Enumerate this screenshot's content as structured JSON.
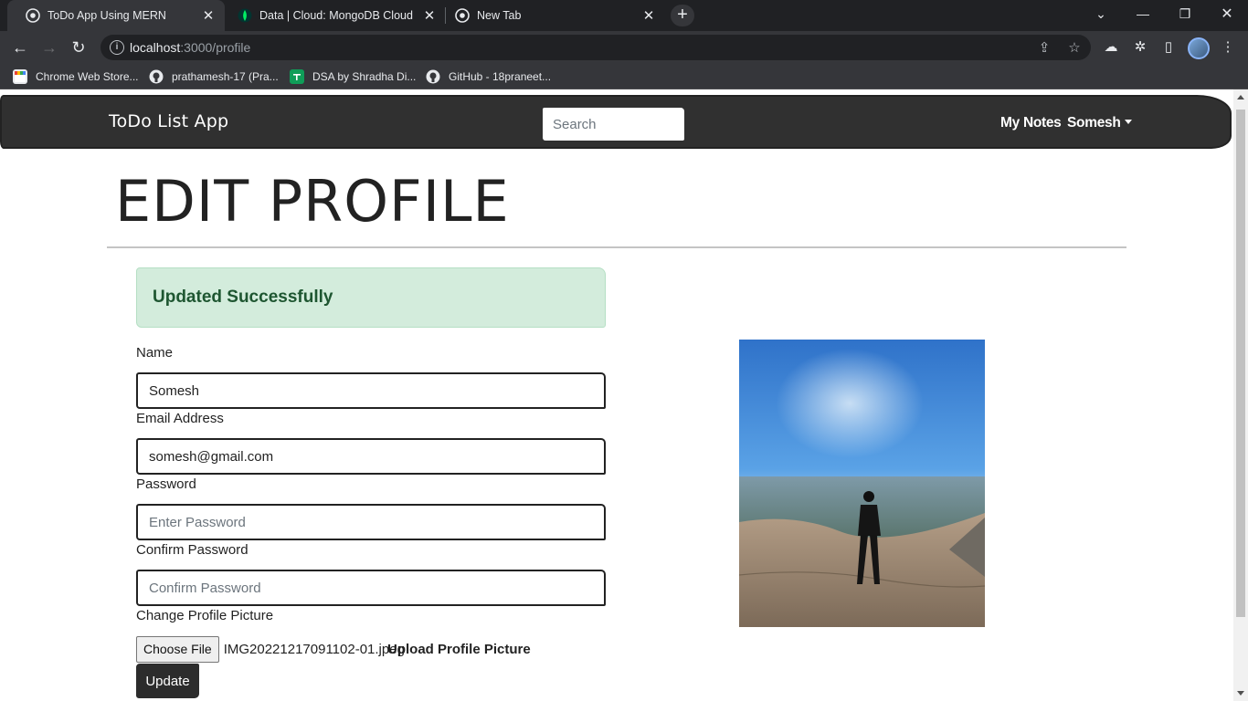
{
  "browser": {
    "tabs": [
      {
        "title": "ToDo App Using MERN",
        "active": true,
        "icon": "chrome-icon"
      },
      {
        "title": "Data | Cloud: MongoDB Cloud",
        "active": false,
        "icon": "mongodb-leaf-icon"
      },
      {
        "title": "New Tab",
        "active": false,
        "icon": "chrome-icon"
      }
    ],
    "url_host": "localhost",
    "url_path": ":3000/profile",
    "bookmarks": [
      {
        "label": "Chrome Web Store...",
        "icon": "chrome-web-store-icon"
      },
      {
        "label": "prathamesh-17 (Pra...",
        "icon": "github-icon"
      },
      {
        "label": "DSA by Shradha Di...",
        "icon": "sheets-icon"
      },
      {
        "label": "GitHub - 18praneet...",
        "icon": "github-icon"
      }
    ]
  },
  "navbar": {
    "brand": "ToDo List App",
    "search_placeholder": "Search",
    "my_notes": "My Notes",
    "user_menu": "Somesh"
  },
  "page": {
    "title": "EDIT PROFILE",
    "alert": "Updated Successfully"
  },
  "form": {
    "name_label": "Name",
    "name_value": "Somesh",
    "email_label": "Email Address",
    "email_value": "somesh@gmail.com",
    "password_label": "Password",
    "password_placeholder": "Enter Password",
    "confirm_label": "Confirm Password",
    "confirm_placeholder": "Confirm Password",
    "picture_label": "Change Profile Picture",
    "choose_file": "Choose File",
    "file_name": "IMG20221217091102-01.jpeg",
    "upload_label": "Upload Profile Picture",
    "update_button": "Update"
  },
  "colors": {
    "navbar_bg": "#303030",
    "alert_bg": "#d3ecdc",
    "alert_text": "#1e5631",
    "button_bg": "#2c2c2c"
  }
}
